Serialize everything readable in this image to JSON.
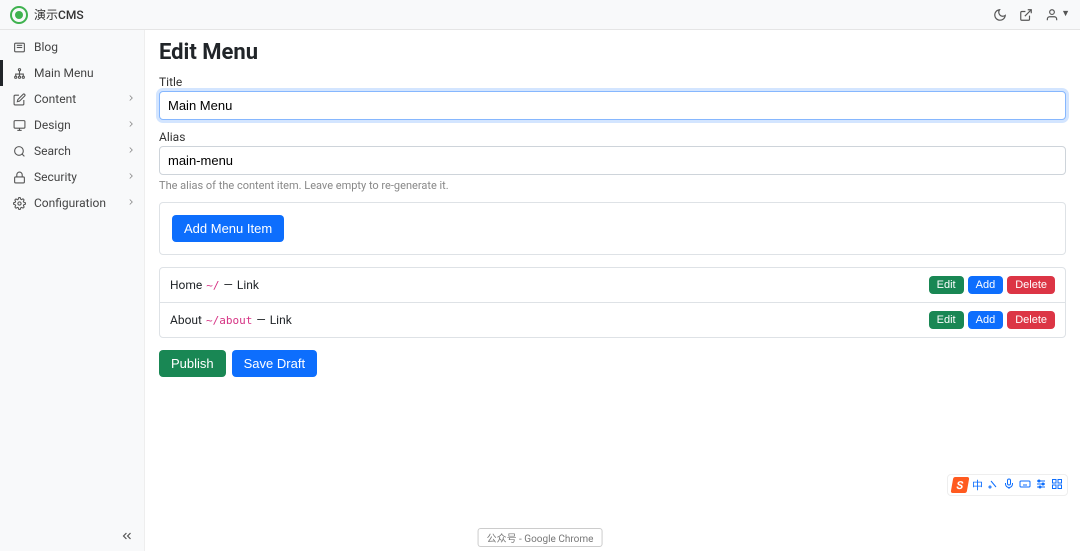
{
  "header": {
    "brand": "演示CMS"
  },
  "sidebar": {
    "items": [
      {
        "label": "Blog",
        "icon": "newspaper",
        "active": false,
        "expandable": false,
        "activePage": true
      },
      {
        "label": "Main Menu",
        "icon": "sitemap",
        "active": true,
        "expandable": false
      },
      {
        "label": "Content",
        "icon": "edit",
        "active": false,
        "expandable": true
      },
      {
        "label": "Design",
        "icon": "monitor",
        "active": false,
        "expandable": true
      },
      {
        "label": "Search",
        "icon": "search",
        "active": false,
        "expandable": true
      },
      {
        "label": "Security",
        "icon": "lock",
        "active": false,
        "expandable": true
      },
      {
        "label": "Configuration",
        "icon": "gear",
        "active": false,
        "expandable": true
      }
    ]
  },
  "page": {
    "title": "Edit Menu",
    "title_field": {
      "label": "Title",
      "value": "Main Menu"
    },
    "alias_field": {
      "label": "Alias",
      "value": "main-menu",
      "help": "The alias of the content item. Leave empty to re-generate it."
    },
    "add_menu_item_label": "Add Menu Item",
    "menu_items": [
      {
        "name": "Home",
        "path": "~/",
        "sep": "—",
        "type": "Link",
        "edit": "Edit",
        "add": "Add",
        "delete": "Delete"
      },
      {
        "name": "About",
        "path": "~/about",
        "sep": "—",
        "type": "Link",
        "edit": "Edit",
        "add": "Add",
        "delete": "Delete"
      }
    ],
    "publish_label": "Publish",
    "save_draft_label": "Save Draft"
  },
  "chrome_bar": "公众号 - Google Chrome",
  "ime": {
    "logo": "S",
    "lang": "中"
  }
}
